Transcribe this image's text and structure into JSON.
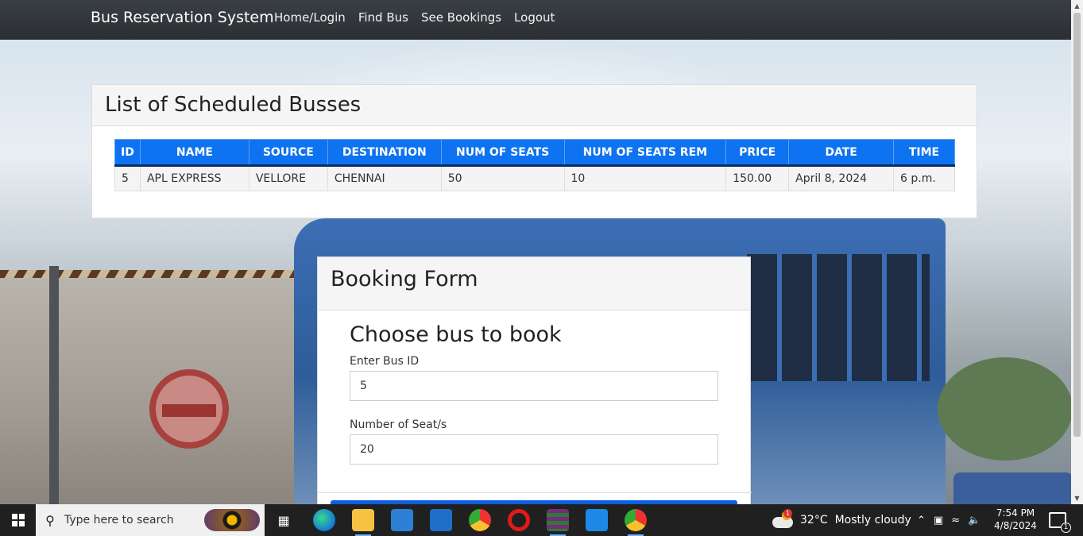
{
  "navbar": {
    "brand": "Bus Reservation System",
    "links": [
      "Home/Login",
      "Find Bus",
      "See Bookings",
      "Logout"
    ]
  },
  "bus_list": {
    "title": "List of Scheduled Busses",
    "columns": [
      "ID",
      "NAME",
      "SOURCE",
      "DESTINATION",
      "NUM OF SEATS",
      "NUM OF SEATS REM",
      "PRICE",
      "DATE",
      "TIME"
    ],
    "rows": [
      [
        "5",
        "APL EXPRESS",
        "VELLORE",
        "CHENNAI",
        "50",
        "10",
        "150.00",
        "April 8, 2024",
        "6 p.m."
      ]
    ]
  },
  "booking": {
    "title": "Booking Form",
    "subtitle": "Choose bus to book",
    "bus_id_label": "Enter Bus ID",
    "bus_id_value": "5",
    "seats_label": "Number of Seat/s",
    "seats_value": "20"
  },
  "taskbar": {
    "search_placeholder": "Type here to search",
    "weather_temp": "32°C",
    "weather_text": "Mostly cloudy",
    "time": "7:54 PM",
    "date": "4/8/2024",
    "weather_badge": "1",
    "notification_count": "1",
    "apps": [
      "task-view-icon",
      "edge-icon",
      "file-explorer-icon",
      "store-icon",
      "mail-icon",
      "chrome-icon",
      "opera-icon",
      "winrar-icon",
      "vscode-icon",
      "chrome-active-icon"
    ]
  }
}
